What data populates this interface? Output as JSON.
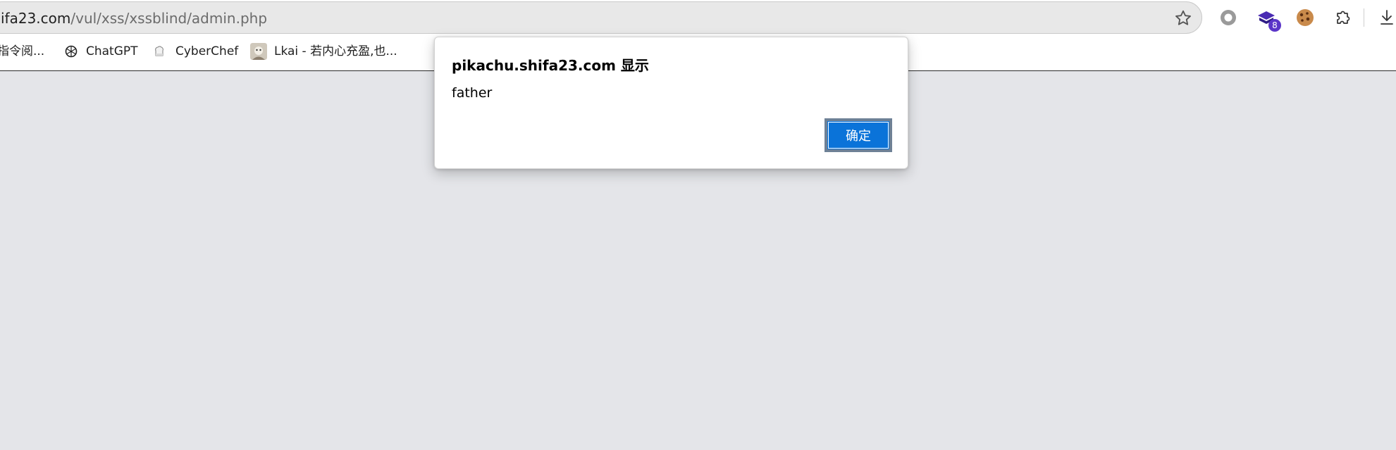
{
  "browser": {
    "address_bar": {
      "url_host": "ifa23.com",
      "url_path": "/vul/xss/xssblind/admin.php"
    },
    "toolbar": {
      "extension_badge_count": "8",
      "icons": [
        "star-icon",
        "record-extension-icon",
        "book-extension-icon",
        "cookie-extension-icon",
        "extensions-puzzle-icon",
        "download-icon"
      ]
    },
    "bookmarks": [
      {
        "label": "指令阅...",
        "icon": ""
      },
      {
        "label": "ChatGPT",
        "icon": "chatgpt-icon"
      },
      {
        "label": "CyberChef",
        "icon": "cyberchef-icon"
      },
      {
        "label": "Lkai - 若内心充盈,也...",
        "icon": "avatar-icon"
      }
    ]
  },
  "dialog": {
    "title": "pikachu.shifa23.com 显示",
    "message": "father",
    "ok_label": "确定"
  },
  "colors": {
    "page_background": "#e4e5e9",
    "ok_button": "#0a73d9",
    "badge": "#5b35c8"
  }
}
